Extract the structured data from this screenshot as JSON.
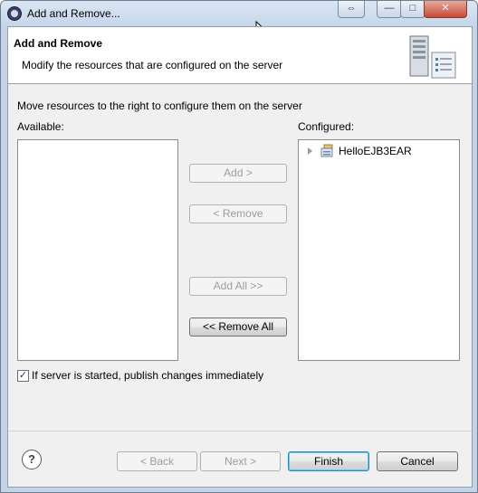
{
  "window": {
    "title": "Add and Remove...",
    "controls": {
      "restore": "⇔",
      "minimize": "—",
      "maximize": "□",
      "close": "✕"
    }
  },
  "banner": {
    "title": "Add and Remove",
    "description": "Modify the resources that are configured on the server",
    "image": "server-config-icon"
  },
  "instruction": "Move resources to the right to configure them on the server",
  "available": {
    "label": "Available:",
    "items": []
  },
  "configured": {
    "label": "Configured:",
    "items": [
      {
        "label": "HelloEJB3EAR",
        "icon": "ear-project-icon",
        "expanded": false
      }
    ]
  },
  "buttons": {
    "add": "Add >",
    "remove": "< Remove",
    "add_all": "Add All >>",
    "remove_all": "<< Remove All"
  },
  "publish_option": {
    "label": "If server is started, publish changes immediately",
    "checked": true
  },
  "footer": {
    "help": "?",
    "back": "< Back",
    "next": "Next >",
    "finish": "Finish",
    "cancel": "Cancel"
  },
  "colors": {
    "titlebar": "#c5d6ea",
    "dialog_bg": "#f0f0f0",
    "default_button_border": "#3c7fb1"
  }
}
